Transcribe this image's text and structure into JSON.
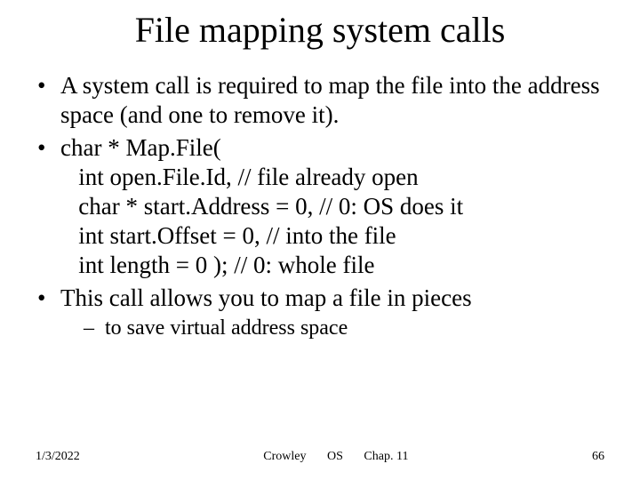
{
  "title": "File mapping system calls",
  "bullets": {
    "b1": "A system call is required to map the file into the address space (and one to remove it).",
    "b2_l1": "char * Map.File(",
    "b2_l2": "   int open.File.Id, // file already open",
    "b2_l3": "   char * start.Address = 0, // 0: OS does it",
    "b2_l4": "   int start.Offset = 0, // into the file",
    "b2_l5": "   int length = 0 ); // 0: whole file",
    "b3": "This call allows you to map a file in pieces",
    "b3_sub1": "to save virtual address space"
  },
  "footer": {
    "date": "1/3/2022",
    "author": "Crowley",
    "course": "OS",
    "chapter": "Chap. 11",
    "page": "66"
  }
}
